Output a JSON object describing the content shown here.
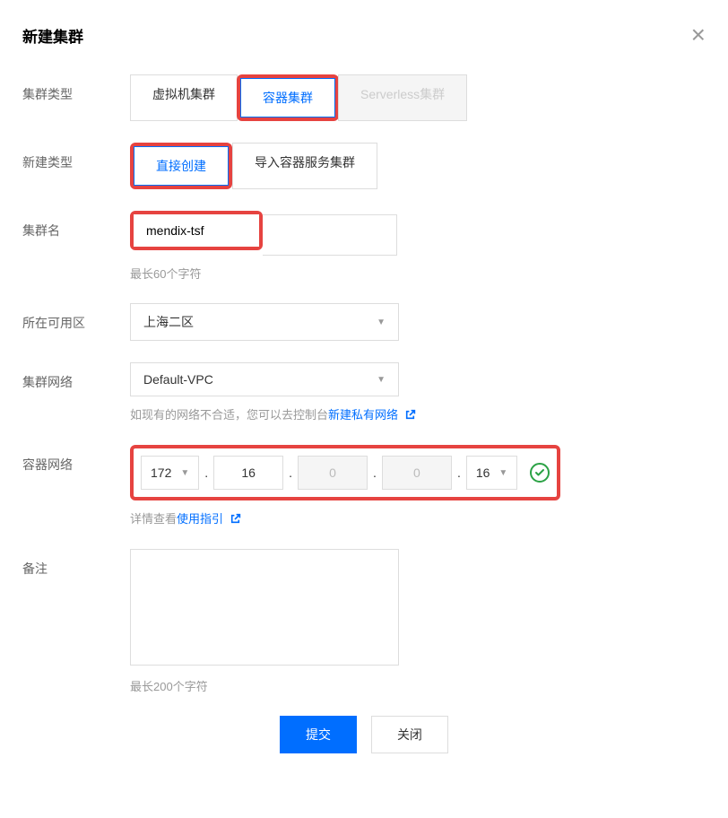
{
  "dialog": {
    "title": "新建集群"
  },
  "cluster_type": {
    "label": "集群类型",
    "options": [
      "虚拟机集群",
      "容器集群",
      "Serverless集群"
    ],
    "selected": 1,
    "disabled_index": 2
  },
  "create_type": {
    "label": "新建类型",
    "options": [
      "直接创建",
      "导入容器服务集群"
    ],
    "selected": 0
  },
  "cluster_name": {
    "label": "集群名",
    "value": "mendix-tsf",
    "hint": "最长60个字符"
  },
  "zone": {
    "label": "所在可用区",
    "value": "上海二区"
  },
  "network": {
    "label": "集群网络",
    "value": "Default-VPC",
    "hint_prefix": "如现有的网络不合适，您可以去控制台",
    "hint_link": "新建私有网络"
  },
  "container_network": {
    "label": "容器网络",
    "ip": {
      "a": "172",
      "b": "16",
      "c": "0",
      "d": "0",
      "mask": "16"
    },
    "hint_prefix": "详情查看",
    "hint_link": "使用指引"
  },
  "remark": {
    "label": "备注",
    "placeholder": "",
    "hint": "最长200个字符"
  },
  "buttons": {
    "submit": "提交",
    "cancel": "关闭"
  }
}
